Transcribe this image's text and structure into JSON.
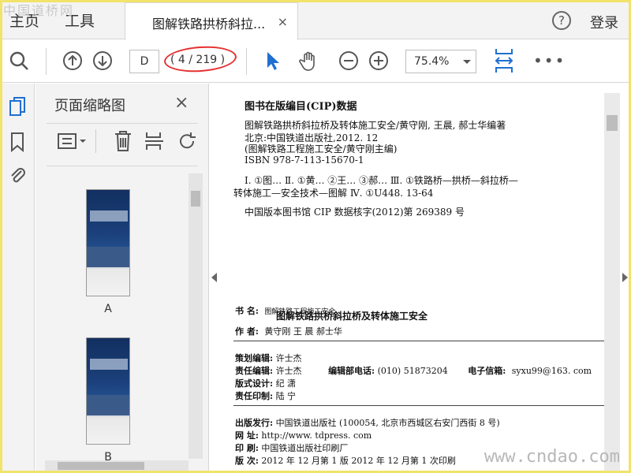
{
  "watermark": {
    "top_left": "中国道桥网",
    "bottom_right": "www.cndao.com"
  },
  "menu": {
    "home": "主页",
    "tools": "工具",
    "login": "登录",
    "help": "?"
  },
  "tab": {
    "title": "图解铁路拱桥斜拉...",
    "close": "×"
  },
  "toolbar": {
    "page_input": "D",
    "page_count": "( 4 / 219 )",
    "zoom": "75.4%",
    "more": "•••"
  },
  "panel": {
    "title": "页面缩略图",
    "close": "×",
    "thumbnails": [
      {
        "label": "A"
      },
      {
        "label": "B"
      }
    ]
  },
  "document": {
    "cip_heading": "图书在版编目(CIP)数据",
    "cip_lines": [
      "图解铁路拱桥斜拉桥及转体施工安全/黄守刚, 王晨, 郝士华编著",
      "北京:中国铁道出版社,2012. 12",
      "(图解铁路工程施工安全/黄守刚主编)",
      "ISBN 978-7-113-15670-1"
    ],
    "cip_subject_1": "Ⅰ. ①图…  Ⅱ. ①黄…  ②王…  ③郝…  Ⅲ. ①铁路桥—拱桥—斜拉桥—",
    "cip_subject_2": "转体施工—安全技术—图解  Ⅳ. ①U448. 13-64",
    "cip_number": "中国版本图书馆 CIP 数据核字(2012)第 269389 号",
    "book_series_label": "书    名:",
    "book_series": "图解铁路工程施工安全",
    "book_title": "图解铁路拱桥斜拉桥及转体施工安全",
    "author_label": "作    者:",
    "author": "黄守刚   王   晨    郝士华",
    "planner_label": "策划编辑:",
    "planner": "许士杰",
    "editor_label": "责任编辑:",
    "editor": "许士杰",
    "phone_label": "编辑部电话:",
    "phone": "(010) 51873204",
    "email_label": "电子信箱:",
    "email": "syxu99@163. com",
    "design_label": "版式设计:",
    "design": "纪   潇",
    "print_label": "责任印制:",
    "print": "陆   宁",
    "publisher_label": "出版发行:",
    "publisher": "中国铁道出版社 (100054, 北京市西城区右安门西街 8 号)",
    "web_label": "网      址:",
    "web": "http://www. tdpress. com",
    "printer_label": "印      刷:",
    "printer": "中国铁道出版社印刷厂",
    "edition_label": "版      次:",
    "edition": "2012 年 12 月第 1 版   2012 年 12 月第 1 次印刷"
  },
  "colors": {
    "accent_blue": "#1f6fd1",
    "annotation_red": "#e53030",
    "frame": "#f2e36b"
  }
}
